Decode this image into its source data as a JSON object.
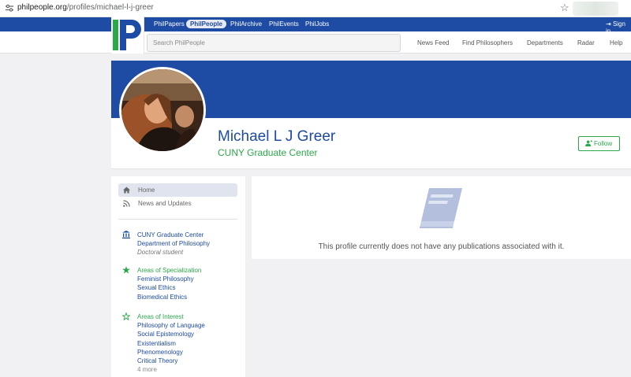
{
  "browser": {
    "url_host": "philpeople.org",
    "url_path": "/profiles/michael-l-j-greer"
  },
  "topnav": {
    "items": [
      "PhilPapers",
      "PhilPeople",
      "PhilArchive",
      "PhilEvents",
      "PhilJobs"
    ],
    "active": "PhilPeople",
    "sign_in": "Sign in"
  },
  "header": {
    "search_placeholder": "Search PhilPeople",
    "links": [
      "News Feed",
      "Find Philosophers",
      "Departments",
      "Radar",
      "Help"
    ]
  },
  "profile": {
    "name": "Michael L J Greer",
    "institution": "CUNY Graduate Center",
    "follow_label": "Follow"
  },
  "sidebar": {
    "nav": [
      {
        "label": "Home",
        "icon": "home-icon",
        "active": true
      },
      {
        "label": "News and Updates",
        "icon": "rss-icon",
        "active": false
      }
    ],
    "affiliation": {
      "institution": "CUNY Graduate Center",
      "department": "Department of Philosophy",
      "role": "Doctoral student"
    },
    "specialization": {
      "heading": "Areas of Specialization",
      "items": [
        "Feminist Philosophy",
        "Sexual Ethics",
        "Biomedical Ethics"
      ]
    },
    "interest": {
      "heading": "Areas of Interest",
      "items": [
        "Philosophy of Language",
        "Social Epistemology",
        "Existentialism",
        "Phenomenology",
        "Critical Theory"
      ],
      "more": "4 more"
    }
  },
  "main": {
    "empty_message": "This profile currently does not have any publications associated with it."
  },
  "colors": {
    "brand_blue": "#1e4ba3",
    "accent_green": "#2ba84a",
    "page_bg": "#f1f1f3"
  }
}
